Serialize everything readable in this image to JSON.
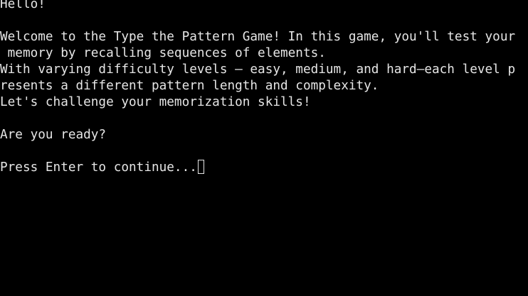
{
  "terminal": {
    "lines": [
      "Hello!",
      "Welcome to the Type the Pattern Game! In this game, you'll test your",
      " memory by recalling sequences of elements.",
      "With varying difficulty levels — easy, medium, and hard—each level p",
      "resents a different pattern length and complexity.",
      "Let's challenge your memorization skills!",
      "Are you ready?",
      "Press Enter to continue..."
    ]
  }
}
